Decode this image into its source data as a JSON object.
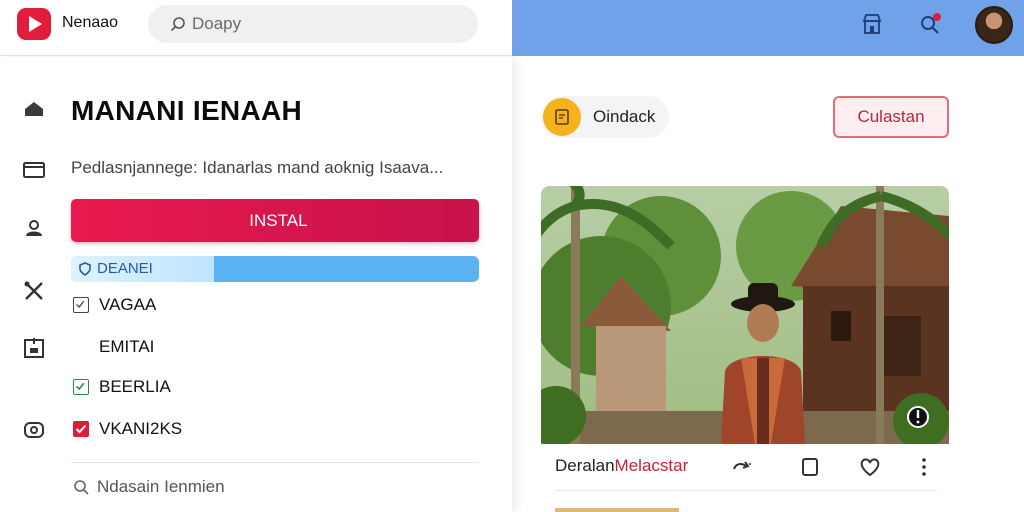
{
  "app": {
    "name": "Nenaao"
  },
  "search": {
    "placeholder": "Doapy"
  },
  "header_icons": [
    "store-icon",
    "search-notification-icon",
    "avatar"
  ],
  "colors": {
    "accent": "#e8194f",
    "topbar_right": "#6fa2e8",
    "progress": "#5ab3f2",
    "chip": "#f5b21a"
  },
  "sidebar_rail": [
    "bag-icon",
    "window-icon",
    "user-icon",
    "tools-icon",
    "calendar-icon",
    "camera-icon"
  ],
  "panel": {
    "title": "MANANI IENAAH",
    "description": "Pedlasnjannege: Idanarlas mand aoknig Isaava...",
    "install_label": "  INSTAL",
    "progress": {
      "label": "DEANEI",
      "value": 0.35
    },
    "options": [
      {
        "label": "VAGAA",
        "state": "unchecked"
      },
      {
        "label": "EMITAI",
        "state": "none"
      },
      {
        "label": "BEERLIA",
        "state": "checked-green"
      },
      {
        "label": "VKANI2KS",
        "state": "checked-red"
      }
    ],
    "bottom_search": "Ndasain Ienmien"
  },
  "content": {
    "chip_label": "Oindack",
    "outline_button": "Culastan",
    "card": {
      "title_main": "Deralan",
      "title_accent": "Melacstar",
      "actions": [
        "share-icon",
        "bookmark-icon",
        "heart-icon",
        "more-icon"
      ]
    }
  }
}
